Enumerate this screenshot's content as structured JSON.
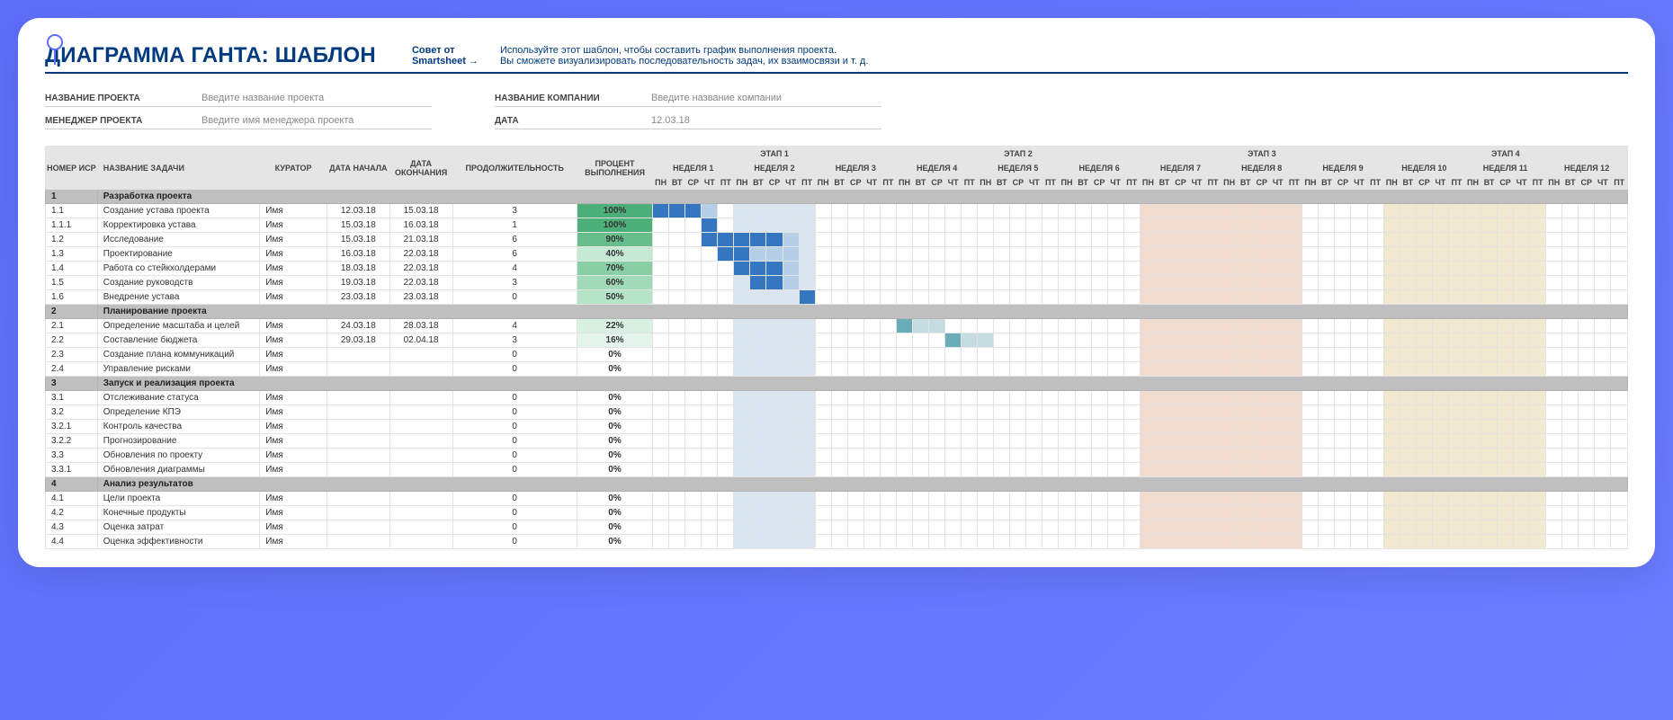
{
  "title": "ДИАГРАММА ГАНТА: ШАБЛОН",
  "tip": {
    "label": "Совет от",
    "link": "Smartsheet →",
    "text1": "Используйте этот шаблон, чтобы составить график выполнения проекта.",
    "text2": "Вы сможете визуализировать последовательность задач, их взаимосвязи и т. д."
  },
  "meta": {
    "project_label": "НАЗВАНИЕ ПРОЕКТА",
    "project_ph": "Введите название проекта",
    "manager_label": "МЕНЕДЖЕР ПРОЕКТА",
    "manager_ph": "Введите имя менеджера проекта",
    "company_label": "НАЗВАНИЕ КОМПАНИИ",
    "company_ph": "Введите название компании",
    "date_label": "ДАТА",
    "date_val": "12.03.18"
  },
  "headers": {
    "wbs": "НОМЕР ИСР",
    "task": "НАЗВАНИЕ ЗАДАЧИ",
    "curator": "КУРАТОР",
    "start": "ДАТА НАЧАЛА",
    "end": "ДАТА ОКОНЧАНИЯ",
    "dur": "ПРОДОЛЖИТЕЛЬНОСТЬ",
    "pct": "ПРОЦЕНТ ВЫПОЛНЕНИЯ"
  },
  "stages": [
    "ЭТАП 1",
    "ЭТАП 2",
    "ЭТАП 3",
    "ЭТАП 4"
  ],
  "weeks": [
    "НЕДЕЛЯ 1",
    "НЕДЕЛЯ 2",
    "НЕДЕЛЯ 3",
    "НЕДЕЛЯ 4",
    "НЕДЕЛЯ 5",
    "НЕДЕЛЯ 6",
    "НЕДЕЛЯ 7",
    "НЕДЕЛЯ 8",
    "НЕДЕЛЯ 9",
    "НЕДЕЛЯ 10",
    "НЕДЕЛЯ 11",
    "НЕДЕЛЯ 12"
  ],
  "days": [
    "ПН",
    "ВТ",
    "СР",
    "ЧТ",
    "ПТ"
  ],
  "sections": [
    {
      "num": "1",
      "title": "Разработка проекта",
      "rows": [
        {
          "wbs": "1.1",
          "task": "Создание устава проекта",
          "cur": "Имя",
          "start": "12.03.18",
          "end": "15.03.18",
          "dur": "3",
          "pct": "100%",
          "pclass": "shade-g100",
          "bar": {
            "s": 0,
            "e": 3,
            "cls": "f1",
            "tail": 1
          }
        },
        {
          "wbs": "1.1.1",
          "task": "Корректировка устава",
          "cur": "Имя",
          "start": "15.03.18",
          "end": "16.03.18",
          "dur": "1",
          "pct": "100%",
          "pclass": "shade-g100",
          "bar": {
            "s": 3,
            "e": 4,
            "cls": "f1",
            "tail": 0
          }
        },
        {
          "wbs": "1.2",
          "task": "Исследование",
          "cur": "Имя",
          "start": "15.03.18",
          "end": "21.03.18",
          "dur": "6",
          "pct": "90%",
          "pclass": "shade-g90",
          "bar": {
            "s": 3,
            "e": 8,
            "cls": "f1",
            "tail": 1
          }
        },
        {
          "wbs": "1.3",
          "task": "Проектирование",
          "cur": "Имя",
          "start": "16.03.18",
          "end": "22.03.18",
          "dur": "6",
          "pct": "40%",
          "pclass": "shade-g40",
          "bar": {
            "s": 4,
            "e": 6,
            "cls": "f1",
            "tail": 3
          }
        },
        {
          "wbs": "1.4",
          "task": "Работа со стейкхолдерами",
          "cur": "Имя",
          "start": "18.03.18",
          "end": "22.03.18",
          "dur": "4",
          "pct": "70%",
          "pclass": "shade-g70",
          "bar": {
            "s": 5,
            "e": 8,
            "cls": "f1",
            "tail": 1
          }
        },
        {
          "wbs": "1.5",
          "task": "Создание руководств",
          "cur": "Имя",
          "start": "19.03.18",
          "end": "22.03.18",
          "dur": "3",
          "pct": "60%",
          "pclass": "shade-g60",
          "bar": {
            "s": 6,
            "e": 8,
            "cls": "f1",
            "tail": 1
          }
        },
        {
          "wbs": "1.6",
          "task": "Внедрение устава",
          "cur": "Имя",
          "start": "23.03.18",
          "end": "23.03.18",
          "dur": "0",
          "pct": "50%",
          "pclass": "shade-g50",
          "bar": {
            "s": 9,
            "e": 10,
            "cls": "f1",
            "tail": 0
          }
        }
      ]
    },
    {
      "num": "2",
      "title": "Планирование проекта",
      "rows": [
        {
          "wbs": "2.1",
          "task": "Определение масштаба и целей",
          "cur": "Имя",
          "start": "24.03.18",
          "end": "28.03.18",
          "dur": "4",
          "pct": "22%",
          "pclass": "shade-g22",
          "bar": {
            "s": 15,
            "e": 16,
            "cls": "f2",
            "tail": 2
          }
        },
        {
          "wbs": "2.2",
          "task": "Составление бюджета",
          "cur": "Имя",
          "start": "29.03.18",
          "end": "02.04.18",
          "dur": "3",
          "pct": "16%",
          "pclass": "shade-g16",
          "bar": {
            "s": 18,
            "e": 19,
            "cls": "f2",
            "tail": 2
          }
        },
        {
          "wbs": "2.3",
          "task": "Создание плана коммуникаций",
          "cur": "Имя",
          "start": "",
          "end": "",
          "dur": "0",
          "pct": "0%",
          "pclass": ""
        },
        {
          "wbs": "2.4",
          "task": "Управление рисками",
          "cur": "Имя",
          "start": "",
          "end": "",
          "dur": "0",
          "pct": "0%",
          "pclass": ""
        }
      ]
    },
    {
      "num": "3",
      "title": "Запуск и реализация проекта",
      "rows": [
        {
          "wbs": "3.1",
          "task": "Отслеживание статуса",
          "cur": "Имя",
          "start": "",
          "end": "",
          "dur": "0",
          "pct": "0%",
          "pclass": ""
        },
        {
          "wbs": "3.2",
          "task": "Определение КПЭ",
          "cur": "Имя",
          "start": "",
          "end": "",
          "dur": "0",
          "pct": "0%",
          "pclass": ""
        },
        {
          "wbs": "3.2.1",
          "task": "Контроль качества",
          "cur": "Имя",
          "start": "",
          "end": "",
          "dur": "0",
          "pct": "0%",
          "pclass": ""
        },
        {
          "wbs": "3.2.2",
          "task": "Прогнозирование",
          "cur": "Имя",
          "start": "",
          "end": "",
          "dur": "0",
          "pct": "0%",
          "pclass": ""
        },
        {
          "wbs": "3.3",
          "task": "Обновления по проекту",
          "cur": "Имя",
          "start": "",
          "end": "",
          "dur": "0",
          "pct": "0%",
          "pclass": ""
        },
        {
          "wbs": "3.3.1",
          "task": "Обновления диаграммы",
          "cur": "Имя",
          "start": "",
          "end": "",
          "dur": "0",
          "pct": "0%",
          "pclass": ""
        }
      ]
    },
    {
      "num": "4",
      "title": "Анализ результатов",
      "rows": [
        {
          "wbs": "4.1",
          "task": "Цели проекта",
          "cur": "Имя",
          "start": "",
          "end": "",
          "dur": "0",
          "pct": "0%",
          "pclass": ""
        },
        {
          "wbs": "4.2",
          "task": "Конечные продукты",
          "cur": "Имя",
          "start": "",
          "end": "",
          "dur": "0",
          "pct": "0%",
          "pclass": ""
        },
        {
          "wbs": "4.3",
          "task": "Оценка затрат",
          "cur": "Имя",
          "start": "",
          "end": "",
          "dur": "0",
          "pct": "0%",
          "pclass": ""
        },
        {
          "wbs": "4.4",
          "task": "Оценка эффективности",
          "cur": "Имя",
          "start": "",
          "end": "",
          "dur": "0",
          "pct": "0%",
          "pclass": ""
        }
      ]
    }
  ],
  "chart_data": {
    "type": "gantt",
    "title": "ДИАГРАММА ГАНТА: ШАБЛОН",
    "x_unit": "рабочий день",
    "x_range": [
      1,
      60
    ],
    "stages": [
      {
        "name": "ЭТАП 1",
        "weeks": [
          "НЕДЕЛЯ 1",
          "НЕДЕЛЯ 2",
          "НЕДЕЛЯ 3"
        ]
      },
      {
        "name": "ЭТАП 2",
        "weeks": [
          "НЕДЕЛЯ 4",
          "НЕДЕЛЯ 5",
          "НЕДЕЛЯ 6"
        ]
      },
      {
        "name": "ЭТАП 3",
        "weeks": [
          "НЕДЕЛЯ 7",
          "НЕДЕЛЯ 8",
          "НЕДЕЛЯ 9"
        ]
      },
      {
        "name": "ЭТАП 4",
        "weeks": [
          "НЕДЕЛЯ 10",
          "НЕДЕЛЯ 11",
          "НЕДЕЛЯ 12"
        ]
      }
    ],
    "day_labels": [
      "ПН",
      "ВТ",
      "СР",
      "ЧТ",
      "ПТ"
    ],
    "tasks": [
      {
        "wbs": "1.1",
        "name": "Создание устава проекта",
        "start": "12.03.18",
        "end": "15.03.18",
        "duration": 3,
        "pct_complete": 100
      },
      {
        "wbs": "1.1.1",
        "name": "Корректировка устава",
        "start": "15.03.18",
        "end": "16.03.18",
        "duration": 1,
        "pct_complete": 100
      },
      {
        "wbs": "1.2",
        "name": "Исследование",
        "start": "15.03.18",
        "end": "21.03.18",
        "duration": 6,
        "pct_complete": 90
      },
      {
        "wbs": "1.3",
        "name": "Проектирование",
        "start": "16.03.18",
        "end": "22.03.18",
        "duration": 6,
        "pct_complete": 40
      },
      {
        "wbs": "1.4",
        "name": "Работа со стейкхолдерами",
        "start": "18.03.18",
        "end": "22.03.18",
        "duration": 4,
        "pct_complete": 70
      },
      {
        "wbs": "1.5",
        "name": "Создание руководств",
        "start": "19.03.18",
        "end": "22.03.18",
        "duration": 3,
        "pct_complete": 60
      },
      {
        "wbs": "1.6",
        "name": "Внедрение устава",
        "start": "23.03.18",
        "end": "23.03.18",
        "duration": 0,
        "pct_complete": 50
      },
      {
        "wbs": "2.1",
        "name": "Определение масштаба и целей",
        "start": "24.03.18",
        "end": "28.03.18",
        "duration": 4,
        "pct_complete": 22
      },
      {
        "wbs": "2.2",
        "name": "Составление бюджета",
        "start": "29.03.18",
        "end": "02.04.18",
        "duration": 3,
        "pct_complete": 16
      },
      {
        "wbs": "2.3",
        "name": "Создание плана коммуникаций",
        "duration": 0,
        "pct_complete": 0
      },
      {
        "wbs": "2.4",
        "name": "Управление рисками",
        "duration": 0,
        "pct_complete": 0
      },
      {
        "wbs": "3.1",
        "name": "Отслеживание статуса",
        "duration": 0,
        "pct_complete": 0
      },
      {
        "wbs": "3.2",
        "name": "Определение КПЭ",
        "duration": 0,
        "pct_complete": 0
      },
      {
        "wbs": "3.2.1",
        "name": "Контроль качества",
        "duration": 0,
        "pct_complete": 0
      },
      {
        "wbs": "3.2.2",
        "name": "Прогнозирование",
        "duration": 0,
        "pct_complete": 0
      },
      {
        "wbs": "3.3",
        "name": "Обновления по проекту",
        "duration": 0,
        "pct_complete": 0
      },
      {
        "wbs": "3.3.1",
        "name": "Обновления диаграммы",
        "duration": 0,
        "pct_complete": 0
      },
      {
        "wbs": "4.1",
        "name": "Цели проекта",
        "duration": 0,
        "pct_complete": 0
      },
      {
        "wbs": "4.2",
        "name": "Конечные продукты",
        "duration": 0,
        "pct_complete": 0
      },
      {
        "wbs": "4.3",
        "name": "Оценка затрат",
        "duration": 0,
        "pct_complete": 0
      },
      {
        "wbs": "4.4",
        "name": "Оценка эффективности",
        "duration": 0,
        "pct_complete": 0
      }
    ]
  }
}
